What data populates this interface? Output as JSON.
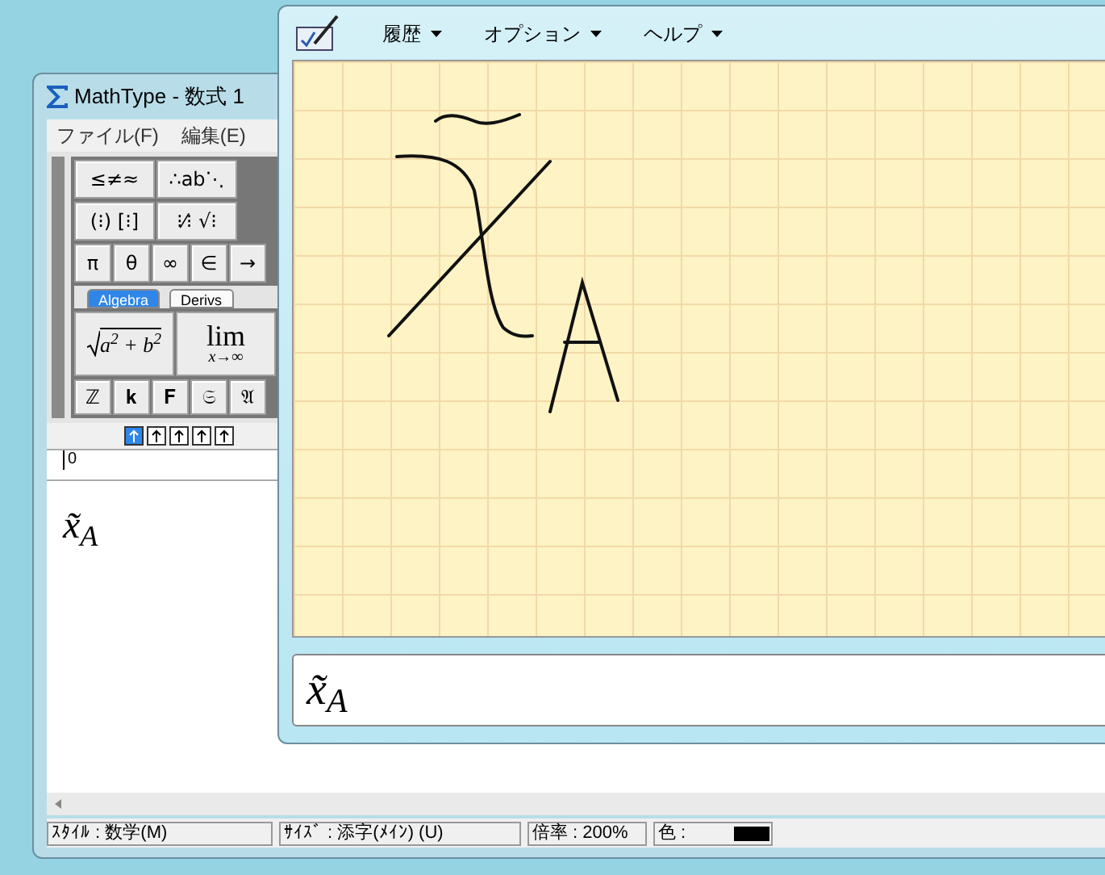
{
  "mathtype_window": {
    "title": "MathType - 数式 1",
    "menu": [
      "ファイル(F)",
      "編集(E)"
    ],
    "palette": {
      "symbol_rows": [
        [
          "≤≠≈",
          "∴ab⋱"
        ],
        [
          "(⁝) [⁝]",
          "⁝⁄⁝ √⁝"
        ],
        [
          "π",
          "θ",
          "∞",
          "∈",
          "→"
        ]
      ],
      "tabs": [
        {
          "label": "Algebra",
          "selected": true
        },
        {
          "label": "Derivs",
          "selected": false
        }
      ],
      "templates": [
        {
          "kind": "sqrt",
          "base": "a$^{2}$ + b$^{2}$"
        },
        {
          "kind": "lim",
          "base": "lim",
          "below": "x→∞"
        }
      ],
      "fonts": [
        "ℤ",
        "𝐤",
        "𝐅",
        "𝔖",
        "𝔄"
      ]
    },
    "ruler_label": "0",
    "equation": "x̃$_{A}$",
    "status_bar": [
      {
        "kind": "text",
        "label": "ｽﾀｲﾙ : 数学(M)"
      },
      {
        "kind": "text",
        "label": "ｻｲｽﾞ : 添字(ﾒｲﾝ) (U)"
      },
      {
        "kind": "text",
        "label": "倍率 : 200%"
      },
      {
        "kind": "swatch",
        "label": "色 :",
        "color": "#000000"
      }
    ]
  },
  "input_panel": {
    "menu": [
      "履歴",
      "オプション",
      "ヘルプ"
    ],
    "preview": "x̃$_{A}$"
  }
}
